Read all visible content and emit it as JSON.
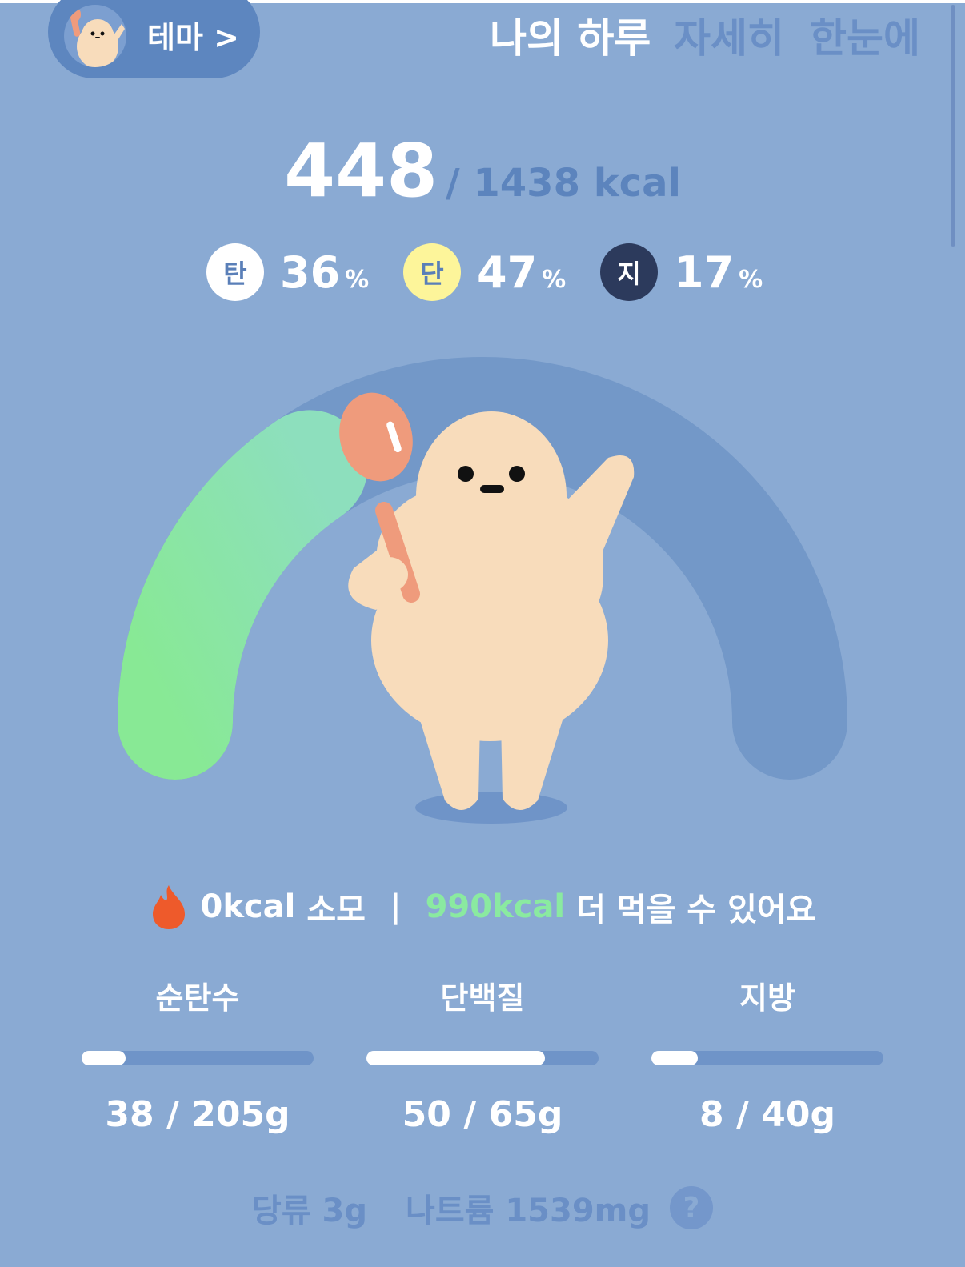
{
  "header": {
    "theme_label": "테마 >",
    "tabs": [
      {
        "label": "나의 하루",
        "active": true
      },
      {
        "label": "자세히",
        "active": false
      },
      {
        "label": "한눈에",
        "active": false
      }
    ]
  },
  "calories": {
    "eaten": "448",
    "goal_text": "/ 1438 kcal",
    "progress": 0.31
  },
  "macro_ratio": [
    {
      "badge": "탄",
      "value": "36",
      "unit": "%",
      "color": "#ffffff",
      "text_color": "#5a7fb8"
    },
    {
      "badge": "단",
      "value": "47",
      "unit": "%",
      "color": "#fdf59a",
      "text_color": "#5a7fb8"
    },
    {
      "badge": "지",
      "value": "17",
      "unit": "%",
      "color": "#2c3a5c",
      "text_color": "#ffffff"
    }
  ],
  "summary": {
    "burned_value": "0kcal",
    "burned_label": "소모",
    "separator": "|",
    "remaining_value": "990kcal",
    "remaining_label": "더 먹을 수 있어요"
  },
  "nutrients": [
    {
      "label": "순탄수",
      "value_text": "38 / 205g",
      "progress": 0.19
    },
    {
      "label": "단백질",
      "value_text": "50 / 65g",
      "progress": 0.77
    },
    {
      "label": "지방",
      "value_text": "8 / 40g",
      "progress": 0.2
    }
  ],
  "extras": {
    "sugar": "당류 3g",
    "sodium": "나트륨 1539mg",
    "help_icon": "?"
  },
  "colors": {
    "background": "#8aaad3",
    "gauge_track": "#7398c8",
    "gauge_fill_start": "#88e995",
    "gauge_fill_end": "#8ddfbd",
    "accent_green": "#8aeaa0",
    "fire": "#ee5a2b"
  }
}
